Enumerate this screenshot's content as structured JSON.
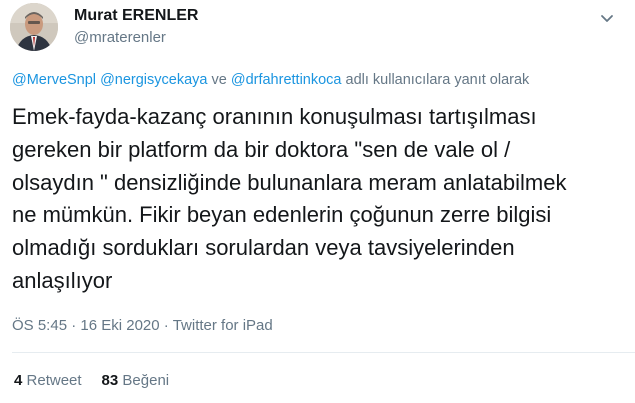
{
  "author": {
    "name": "Murat ERENLER",
    "handle": "@mraterenler"
  },
  "icons": {
    "avatar": "profile-photo",
    "more": "chevron-down-icon"
  },
  "reply_context": {
    "mentions": [
      "@MerveSnpl",
      "@nergisycekaya",
      "@drfahrettinkoca"
    ],
    "separator_1": " ",
    "separator_2": " ve ",
    "suffix": " adlı kullanıcılara yanıt olarak"
  },
  "tweet": {
    "lines": [
      "Emek-fayda-kazanç oranının konuşulması tartışılması",
      "gereken bir platform da bir doktora \"sen de vale ol /",
      "olsaydın \" densizliğinde bulunanlara meram anlatabilmek",
      "ne mümkün. Fikir beyan edenlerin çoğunun zerre bilgisi",
      "olmadığı sordukları sorulardan veya tavsiyelerinden",
      "anlaşılıyor"
    ]
  },
  "meta": {
    "time": "ÖS 5:45",
    "dot": " · ",
    "date": "16 Eki 2020",
    "source": "Twitter for iPad"
  },
  "stats": {
    "retweets_count": "4",
    "retweets_label": "Retweet",
    "likes_count": "83",
    "likes_label": "Beğeni"
  },
  "colors": {
    "link": "#1b95e0",
    "secondary": "#657786",
    "primary_text": "#14171a",
    "divider": "#e6ecf0"
  }
}
